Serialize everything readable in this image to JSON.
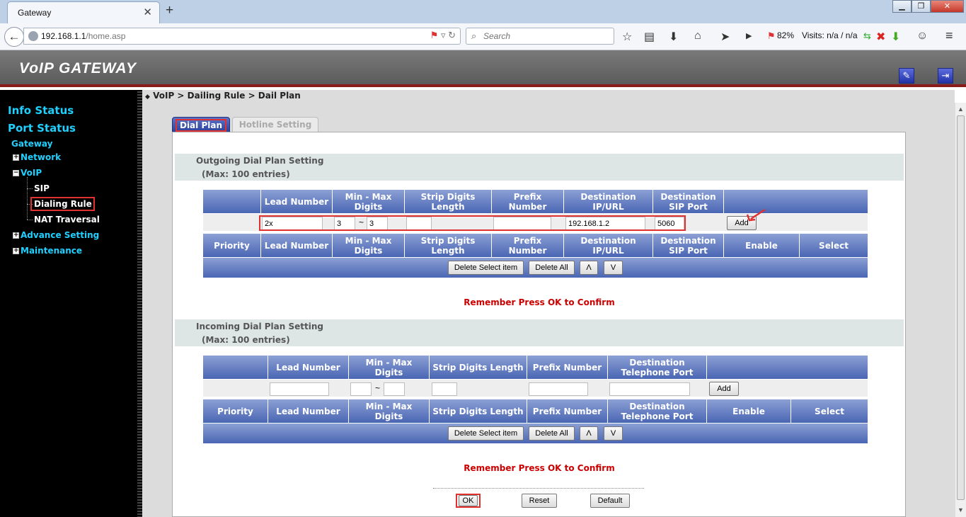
{
  "browser": {
    "tab_title": "Gateway",
    "url_host": "192.168.1.1",
    "url_path": "/home.asp",
    "search_placeholder": "Search",
    "battery": "82%",
    "visits": "Visits: n/a / n/a"
  },
  "header": {
    "logo": "VoIP GATEWAY"
  },
  "sidebar": {
    "info_status": "Info Status",
    "port_status": "Port Status",
    "gateway": "Gateway",
    "network": "Network",
    "voip": "VoIP",
    "sip": "SIP",
    "dialing_rule": "Dialing Rule",
    "nat_traversal": "NAT Traversal",
    "advance_setting": "Advance Setting",
    "maintenance": "Maintenance"
  },
  "breadcrumb": "VoIP > Dailing Rule > Dail Plan",
  "tabs": {
    "dial_plan": "Dial Plan",
    "hotline": "Hotline Setting"
  },
  "outgoing": {
    "title": "Outgoing Dial Plan Setting",
    "max": "(Max: 100 entries)",
    "headers": [
      "Lead Number",
      "Min - Max Digits",
      "Strip Digits Length",
      "Prefix Number",
      "Destination IP/URL",
      "Destination SIP Port"
    ],
    "list_headers": [
      "Priority",
      "Lead Number",
      "Min - Max Digits",
      "Strip Digits Length",
      "Prefix Number",
      "Destination IP/URL",
      "Destination SIP Port",
      "Enable",
      "Select"
    ],
    "values": {
      "lead": "2x",
      "min": "3",
      "max": "3",
      "strip": "",
      "prefix": "",
      "dest_ip": "192.168.1.2",
      "port": "5060"
    },
    "add": "Add"
  },
  "incoming": {
    "title": "Incoming Dial Plan Setting",
    "max": "(Max: 100 entries)",
    "headers": [
      "Lead Number",
      "Min - Max Digits",
      "Strip Digits Length",
      "Prefix Number",
      "Destination Telephone Port"
    ],
    "list_headers": [
      "Priority",
      "Lead Number",
      "Min - Max Digits",
      "Strip Digits Length",
      "Prefix Number",
      "Destination Telephone Port",
      "Enable",
      "Select"
    ],
    "add": "Add"
  },
  "actions": {
    "delete_select": "Delete Select item",
    "delete_all": "Delete All",
    "up": "Λ",
    "down": "V"
  },
  "remember": "Remember Press OK to Confirm",
  "footer": {
    "ok": "OK",
    "reset": "Reset",
    "default": "Default"
  }
}
